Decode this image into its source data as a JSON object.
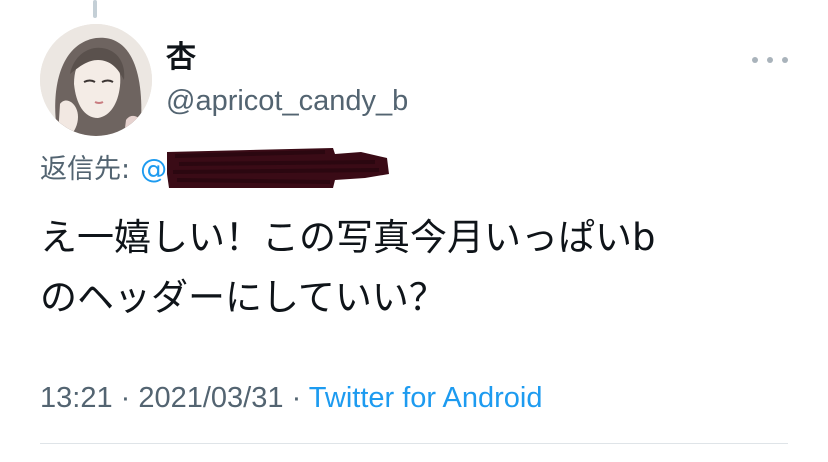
{
  "tweet": {
    "author": {
      "display_name": "杏",
      "handle": "@apricot_candy_b"
    },
    "reply_to": {
      "label": "返信先:",
      "handle_visible": "@"
    },
    "text": "え一嬉しい！この写真今月いっぱいb\nのヘッダーにしていい？",
    "time": "13:21",
    "separator": " · ",
    "date": "2021/03/31",
    "source": "Twitter for Android"
  },
  "icons": {
    "more": "more-horizontal-icon",
    "avatar": "avatar-image",
    "redaction": "redaction-scribble"
  },
  "colors": {
    "link": "#1d9bf0",
    "secondary_text": "#536471",
    "primary_text": "#0f1419",
    "redaction": "#3a0b16"
  }
}
